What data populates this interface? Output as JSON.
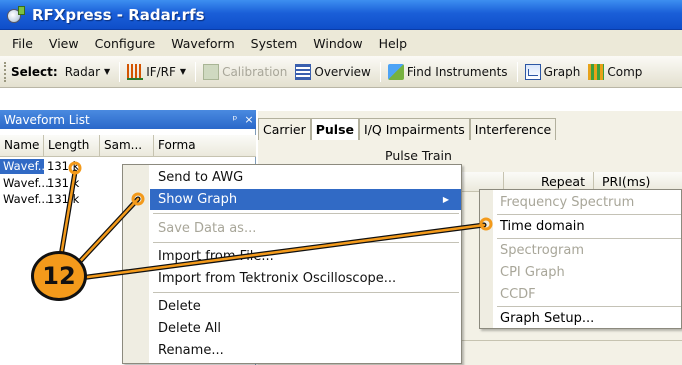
{
  "window": {
    "title": "RFXpress - Radar.rfs"
  },
  "menubar": [
    "File",
    "View",
    "Configure",
    "Waveform",
    "System",
    "Window",
    "Help"
  ],
  "toolbar": {
    "select_label": "Select:",
    "radar_label": "Radar",
    "ifrf_label": "IF/RF",
    "calibration_label": "Calibration",
    "overview_label": "Overview",
    "find_label": "Find Instruments",
    "graph_label": "Graph",
    "comp_label": "Comp"
  },
  "waveform_list": {
    "title": "Waveform List",
    "pin_icon": "pin-icon",
    "close_icon": "close-icon",
    "columns": [
      "Name",
      "Length",
      "Sam...",
      "Forma"
    ],
    "rows": [
      {
        "name": "Wavef...",
        "length": "131 k"
      },
      {
        "name": "Wavef...",
        "length": "131 k"
      },
      {
        "name": "Wavef...",
        "length": "131 k"
      }
    ]
  },
  "tabs": [
    "Carrier",
    "Pulse",
    "I/Q Impairments",
    "Interference"
  ],
  "pulse": {
    "section_title": "Pulse Train",
    "grid_headers": [
      "pe",
      "Repeat",
      "PRI(ms)"
    ]
  },
  "context_menu": {
    "items": {
      "send_to_awg": "Send to AWG",
      "show_graph": "Show Graph",
      "save_data_as": "Save Data as...",
      "import_from_file": "Import from File...",
      "import_from_tek": "Import from Tektronix Oscilloscope...",
      "delete": "Delete",
      "delete_all": "Delete All",
      "rename": "Rename..."
    }
  },
  "submenu": {
    "items": {
      "frequency_spectrum": "Frequency Spectrum",
      "time_domain": "Time domain",
      "spectrogram": "Spectrogram",
      "cpi_graph": "CPI Graph",
      "ccdf": "CCDF",
      "graph_setup": "Graph Setup..."
    }
  },
  "callout": {
    "number": "12",
    "color": "#f39a1b"
  },
  "colors": {
    "title_bar": "#1a5fd8",
    "selection": "#316ac5",
    "menu_bg": "#ece9d8"
  }
}
